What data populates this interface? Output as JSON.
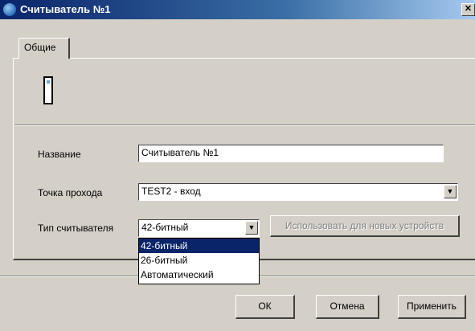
{
  "window": {
    "title": "Считыватель №1",
    "close_glyph": "✕"
  },
  "tabs": [
    {
      "label": "Общие"
    }
  ],
  "form": {
    "name_label": "Название",
    "name_value": "Считыватель №1",
    "point_label": "Точка прохода",
    "point_value": "TEST2 - вход",
    "type_label": "Тип считывателя",
    "type_value": "42-битный",
    "use_new_devices_label": "Использовать для новых устройств"
  },
  "reader_type_options": [
    {
      "label": "42-битный",
      "selected": true
    },
    {
      "label": "26-битный",
      "selected": false
    },
    {
      "label": "Автоматический",
      "selected": false
    }
  ],
  "footer": {
    "ok_label": "ОК",
    "cancel_label": "Отмена",
    "apply_label": "Применить"
  },
  "colors": {
    "title_bar": "#0a246a",
    "window_bg": "#d4d0c8",
    "selection": "#0a246a"
  }
}
